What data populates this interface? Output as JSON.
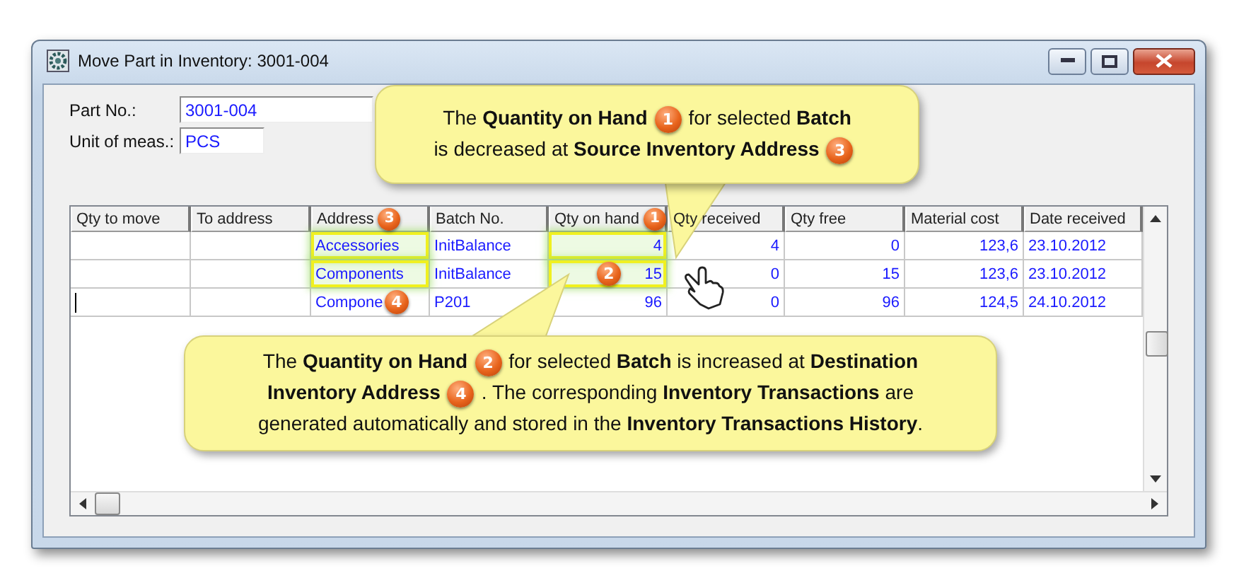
{
  "window": {
    "title": "Move Part in Inventory: 3001-004"
  },
  "fields": [
    {
      "label": "Part No.:",
      "value": "3001-004"
    },
    {
      "label": "Unit of meas.:",
      "value": "PCS"
    }
  ],
  "table": {
    "columns": [
      {
        "label": "Qty to move"
      },
      {
        "label": "To address"
      },
      {
        "label": "Address",
        "badge": "3"
      },
      {
        "label": "Batch No."
      },
      {
        "label": "Qty on hand",
        "badge": "1"
      },
      {
        "label": "Qty received"
      },
      {
        "label": "Qty free"
      },
      {
        "label": "Material cost"
      },
      {
        "label": "Date received"
      }
    ],
    "rows": [
      {
        "editing": false,
        "highlighted": true,
        "cells": [
          {
            "text": ""
          },
          {
            "text": ""
          },
          {
            "text": "Accessories"
          },
          {
            "text": "InitBalance"
          },
          {
            "text": "4"
          },
          {
            "text": "4"
          },
          {
            "text": "0"
          },
          {
            "text": "123,6"
          },
          {
            "text": "23.10.2012"
          }
        ]
      },
      {
        "editing": false,
        "highlighted": true,
        "cells": [
          {
            "text": ""
          },
          {
            "text": ""
          },
          {
            "text": "Components"
          },
          {
            "text": "InitBalance"
          },
          {
            "text": "15",
            "badge": "2"
          },
          {
            "text": "0"
          },
          {
            "text": "15"
          },
          {
            "text": "123,6"
          },
          {
            "text": "23.10.2012"
          }
        ]
      },
      {
        "editing": true,
        "highlighted": false,
        "cells": [
          {
            "text": ""
          },
          {
            "text": ""
          },
          {
            "text": "Compone",
            "badge": "4"
          },
          {
            "text": "P201"
          },
          {
            "text": "96"
          },
          {
            "text": "0"
          },
          {
            "text": "96"
          },
          {
            "text": "124,5"
          },
          {
            "text": "24.10.2012"
          }
        ]
      }
    ]
  },
  "callouts": [
    {
      "segments": [
        {
          "kind": "text",
          "text": "The **Quantity on Hand**"
        },
        {
          "kind": "badge",
          "text": "1"
        },
        {
          "kind": "text",
          "text": "for selected **Batch**"
        },
        {
          "kind": "break"
        },
        {
          "kind": "text",
          "text": "is decreased at **Source Inventory Address**"
        },
        {
          "kind": "badge",
          "text": "3"
        }
      ]
    },
    {
      "segments": [
        {
          "kind": "text",
          "text": "The **Quantity on Hand**"
        },
        {
          "kind": "badge",
          "text": "2"
        },
        {
          "kind": "text",
          "text": "for selected **Batch** is increased at **Destination**"
        },
        {
          "kind": "break"
        },
        {
          "kind": "text",
          "text": "**Inventory Address**"
        },
        {
          "kind": "badge",
          "text": "4"
        },
        {
          "kind": "text",
          "text": ". The corresponding **Inventory Transactions** are"
        },
        {
          "kind": "break"
        },
        {
          "kind": "text",
          "text": "generated automatically and stored in the **Inventory Transactions History**."
        }
      ]
    }
  ]
}
